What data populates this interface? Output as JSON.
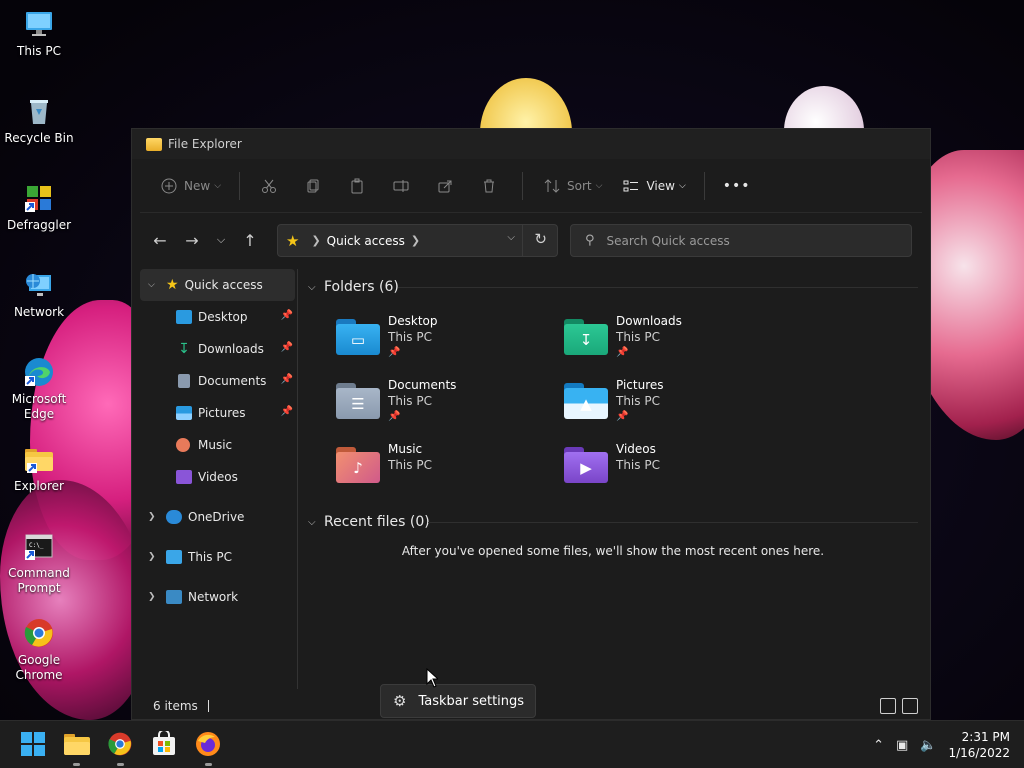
{
  "desktop": {
    "icons": [
      {
        "label": "This PC",
        "icon": "this-pc-icon"
      },
      {
        "label": "Recycle Bin",
        "icon": "recycle-bin-icon"
      },
      {
        "label": "Defraggler",
        "icon": "defraggler-icon"
      },
      {
        "label": "Network",
        "icon": "network-icon"
      },
      {
        "label": "Microsoft Edge",
        "icon": "edge-icon"
      },
      {
        "label": "Explorer",
        "icon": "explorer-icon"
      },
      {
        "label": "Command Prompt",
        "icon": "command-prompt-icon"
      },
      {
        "label": "Google Chrome",
        "icon": "chrome-icon"
      }
    ]
  },
  "window": {
    "title": "File Explorer",
    "toolbar": {
      "new_label": "New",
      "sort_label": "Sort",
      "view_label": "View",
      "more_label": "•••"
    },
    "address": {
      "location": "Quick access"
    },
    "search": {
      "placeholder": "Search Quick access"
    },
    "sidebar": {
      "quick_access": "Quick access",
      "pinned": [
        {
          "label": "Desktop",
          "pinned": true
        },
        {
          "label": "Downloads",
          "pinned": true
        },
        {
          "label": "Documents",
          "pinned": true
        },
        {
          "label": "Pictures",
          "pinned": true
        },
        {
          "label": "Music",
          "pinned": false
        },
        {
          "label": "Videos",
          "pinned": false
        }
      ],
      "onedrive": "OneDrive",
      "this_pc": "This PC",
      "network": "Network"
    },
    "content": {
      "folders_heading": "Folders (6)",
      "folders": [
        {
          "name": "Desktop",
          "location": "This PC",
          "pinned": true
        },
        {
          "name": "Downloads",
          "location": "This PC",
          "pinned": true
        },
        {
          "name": "Documents",
          "location": "This PC",
          "pinned": true
        },
        {
          "name": "Pictures",
          "location": "This PC",
          "pinned": true
        },
        {
          "name": "Music",
          "location": "This PC",
          "pinned": false
        },
        {
          "name": "Videos",
          "location": "This PC",
          "pinned": false
        }
      ],
      "recent_heading": "Recent files (0)",
      "recent_empty": "After you've opened some files, we'll show the most recent ones here."
    },
    "status": {
      "items": "6 items"
    }
  },
  "tooltip": {
    "label": "Taskbar settings"
  },
  "taskbar": {
    "clock_time": "2:31 PM",
    "clock_date": "1/16/2022"
  },
  "colors": {
    "accent": "#f5c518",
    "desktop_folder": "#1e90d8",
    "downloads_folder": "#1aa87a",
    "documents_folder": "#8a9aae",
    "pictures_folder": "#1a9ae0",
    "music_folder": "#e87a5a",
    "videos_folder": "#8a55d8"
  }
}
